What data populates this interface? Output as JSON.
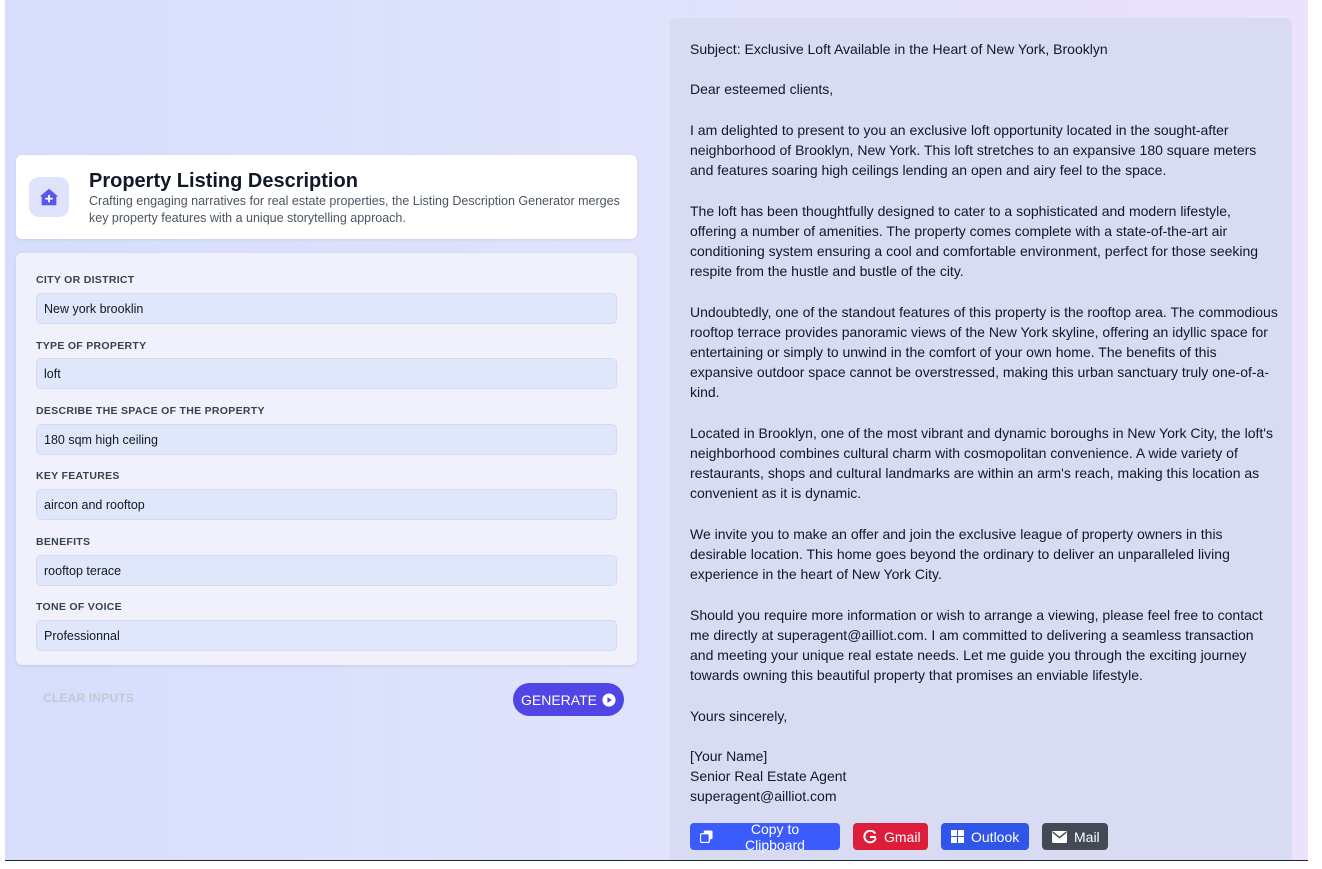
{
  "header": {
    "title": "Property Listing Description",
    "subtitle": "Crafting engaging narratives for real estate properties, the Listing Description Generator merges key property features with a unique storytelling approach.",
    "icon": "house-icon"
  },
  "form": {
    "fields": [
      {
        "label": "CITY OR DISTRICT",
        "value": "New york brooklin"
      },
      {
        "label": "TYPE OF PROPERTY",
        "value": "loft"
      },
      {
        "label": "DESCRIBE THE SPACE OF THE PROPERTY",
        "value": "180 sqm high ceiling"
      },
      {
        "label": "KEY FEATURES",
        "value": "aircon and rooftop"
      },
      {
        "label": "BENEFITS",
        "value": "rooftop terace"
      },
      {
        "label": "TONE OF VOICE",
        "value": "Professionnal"
      }
    ]
  },
  "actions": {
    "clear_label": "CLEAR INPUTS",
    "generate_label": "GENERATE"
  },
  "output": {
    "subject": "Subject: Exclusive Loft Available in the Heart of New York, Brooklyn",
    "greeting": "Dear esteemed clients,",
    "paragraphs": [
      "I am delighted to present to you an exclusive loft opportunity located in the sought-after neighborhood of Brooklyn, New York. This loft stretches to an expansive 180 square meters and features soaring high ceilings lending an open and airy feel to the space.",
      "The loft has been thoughtfully designed to cater to a sophisticated and modern lifestyle, offering a number of amenities. The property comes complete with a state-of-the-art air conditioning system ensuring a cool and comfortable environment, perfect for those seeking respite from the hustle and bustle of the city.",
      "Undoubtedly, one of the standout features of this property is the rooftop area. The commodious rooftop terrace provides panoramic views of the New York skyline, offering an idyllic space for entertaining or simply to unwind in the comfort of your own home. The benefits of this expansive outdoor space cannot be overstressed, making this urban sanctuary truly one-of-a-kind.",
      "Located in Brooklyn, one of the most vibrant and dynamic boroughs in New York City, the loft's neighborhood combines cultural charm with cosmopolitan convenience. A wide variety of restaurants, shops and cultural landmarks are within an arm's reach, making this location as convenient as it is dynamic.",
      "We invite you to make an offer and join the exclusive league of property owners in this desirable location. This home goes beyond the ordinary to deliver an unparalleled living experience in the heart of New York City.",
      "Should you require more information or wish to arrange a viewing, please feel free to contact me directly at superagent@ailliot.com. I am committed to delivering a seamless transaction and meeting your unique real estate needs. Let me guide you through the exciting journey towards owning this beautiful property that promises an enviable lifestyle."
    ],
    "closing": "Yours sincerely,",
    "signature_name": "[Your Name]",
    "signature_title": "Senior Real Estate Agent",
    "signature_email": "superagent@ailliot.com"
  },
  "share": {
    "copy_label": "Copy to Clipboard",
    "gmail_label": "Gmail",
    "outlook_label": "Outlook",
    "mail_label": "Mail"
  },
  "colors": {
    "accent": "#4f46e5",
    "copy": "#3b5bfd",
    "gmail": "#dc1e3a",
    "outlook": "#2f56e8",
    "mail": "#434955"
  }
}
